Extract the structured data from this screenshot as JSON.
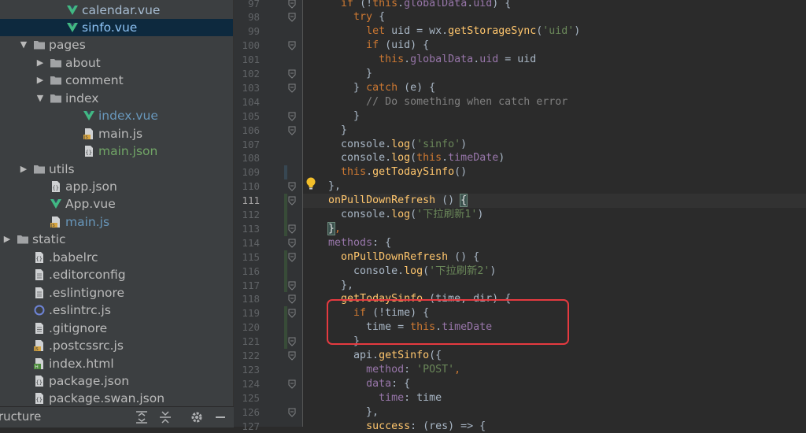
{
  "project_tree": {
    "items": [
      {
        "label": "calendar.vue",
        "depth": 3,
        "arrow": "",
        "icon": "vue-file-icon",
        "style": "vue"
      },
      {
        "label": "sinfo.vue",
        "depth": 3,
        "arrow": "",
        "icon": "vue-file-icon",
        "style": "sel",
        "selected": true
      },
      {
        "label": "pages",
        "depth": 1,
        "arrow": "down",
        "icon": "folder-icon",
        "style": ""
      },
      {
        "label": "about",
        "depth": 2,
        "arrow": "right",
        "icon": "folder-icon",
        "style": ""
      },
      {
        "label": "comment",
        "depth": 2,
        "arrow": "right",
        "icon": "folder-icon",
        "style": ""
      },
      {
        "label": "index",
        "depth": 2,
        "arrow": "down",
        "icon": "folder-icon",
        "style": ""
      },
      {
        "label": "index.vue",
        "depth": 4,
        "arrow": "",
        "icon": "vue-file-icon",
        "style": "blue"
      },
      {
        "label": "main.js",
        "depth": 4,
        "arrow": "",
        "icon": "js-file-icon",
        "style": ""
      },
      {
        "label": "main.json",
        "depth": 4,
        "arrow": "",
        "icon": "json-file-icon",
        "style": "green"
      },
      {
        "label": "utils",
        "depth": 1,
        "arrow": "right",
        "icon": "folder-icon",
        "style": ""
      },
      {
        "label": "app.json",
        "depth": 2,
        "arrow": "",
        "icon": "json-file-icon",
        "style": ""
      },
      {
        "label": "App.vue",
        "depth": 2,
        "arrow": "",
        "icon": "vue-file-icon",
        "style": ""
      },
      {
        "label": "main.js",
        "depth": 2,
        "arrow": "",
        "icon": "js-file-icon",
        "style": "blue"
      },
      {
        "label": "static",
        "depth": 0,
        "arrow": "right",
        "icon": "folder-icon",
        "style": ""
      },
      {
        "label": ".babelrc",
        "depth": 1,
        "arrow": "",
        "icon": "config-file-icon",
        "style": ""
      },
      {
        "label": ".editorconfig",
        "depth": 1,
        "arrow": "",
        "icon": "text-file-icon",
        "style": ""
      },
      {
        "label": ".eslintignore",
        "depth": 1,
        "arrow": "",
        "icon": "text-file-icon",
        "style": ""
      },
      {
        "label": ".eslintrc.js",
        "depth": 1,
        "arrow": "",
        "icon": "eslint-file-icon",
        "style": ""
      },
      {
        "label": ".gitignore",
        "depth": 1,
        "arrow": "",
        "icon": "text-file-icon",
        "style": ""
      },
      {
        "label": ".postcssrc.js",
        "depth": 1,
        "arrow": "",
        "icon": "js-file-icon",
        "style": ""
      },
      {
        "label": "index.html",
        "depth": 1,
        "arrow": "",
        "icon": "html-file-icon",
        "style": ""
      },
      {
        "label": "package.json",
        "depth": 1,
        "arrow": "",
        "icon": "json-file-icon",
        "style": ""
      },
      {
        "label": "package.swan.json",
        "depth": 1,
        "arrow": "",
        "icon": "json-file-icon",
        "style": ""
      }
    ]
  },
  "structure_bar": {
    "label": "ructure"
  },
  "editor": {
    "current_line": 111,
    "lines": [
      {
        "n": 97,
        "tokens": [
          [
            "plain",
            "      "
          ],
          [
            "kw",
            "if"
          ],
          [
            "plain",
            " (!"
          ],
          [
            "kw",
            "this"
          ],
          [
            "plain",
            "."
          ],
          [
            "prop",
            "globalData"
          ],
          [
            "plain",
            "."
          ],
          [
            "prop",
            "uid"
          ],
          [
            "plain",
            ") {"
          ]
        ]
      },
      {
        "n": 98,
        "tokens": [
          [
            "plain",
            "        "
          ],
          [
            "kw",
            "try"
          ],
          [
            "plain",
            " {"
          ]
        ]
      },
      {
        "n": 99,
        "tokens": [
          [
            "plain",
            "          "
          ],
          [
            "kw",
            "let"
          ],
          [
            "plain",
            " uid = "
          ],
          [
            "plain",
            "wx"
          ],
          [
            "plain",
            "."
          ],
          [
            "fn",
            "getStorageSync"
          ],
          [
            "plain",
            "("
          ],
          [
            "str",
            "'uid'"
          ],
          [
            "plain",
            ")"
          ]
        ]
      },
      {
        "n": 100,
        "tokens": [
          [
            "plain",
            "          "
          ],
          [
            "kw",
            "if"
          ],
          [
            "plain",
            " (uid) {"
          ]
        ]
      },
      {
        "n": 101,
        "tokens": [
          [
            "plain",
            "            "
          ],
          [
            "kw",
            "this"
          ],
          [
            "plain",
            "."
          ],
          [
            "prop",
            "globalData"
          ],
          [
            "plain",
            "."
          ],
          [
            "prop",
            "uid"
          ],
          [
            "plain",
            " = uid"
          ]
        ]
      },
      {
        "n": 102,
        "tokens": [
          [
            "plain",
            "          }"
          ]
        ]
      },
      {
        "n": 103,
        "tokens": [
          [
            "plain",
            "        } "
          ],
          [
            "kw",
            "catch"
          ],
          [
            "plain",
            " (e) {"
          ]
        ]
      },
      {
        "n": 104,
        "tokens": [
          [
            "plain",
            "          "
          ],
          [
            "cm",
            "// Do something when catch error"
          ]
        ]
      },
      {
        "n": 105,
        "tokens": [
          [
            "plain",
            "        }"
          ]
        ]
      },
      {
        "n": 106,
        "tokens": [
          [
            "plain",
            "      }"
          ]
        ]
      },
      {
        "n": 107,
        "tokens": [
          [
            "plain",
            "      console."
          ],
          [
            "fn",
            "log"
          ],
          [
            "plain",
            "("
          ],
          [
            "str",
            "'sinfo'"
          ],
          [
            "plain",
            ")"
          ]
        ]
      },
      {
        "n": 108,
        "tokens": [
          [
            "plain",
            "      console."
          ],
          [
            "fn",
            "log"
          ],
          [
            "plain",
            "("
          ],
          [
            "kw",
            "this"
          ],
          [
            "plain",
            "."
          ],
          [
            "prop",
            "timeDate"
          ],
          [
            "plain",
            ")"
          ]
        ]
      },
      {
        "n": 109,
        "tokens": [
          [
            "plain",
            "      "
          ],
          [
            "kw",
            "this"
          ],
          [
            "plain",
            "."
          ],
          [
            "fn",
            "getTodaySinfo"
          ],
          [
            "plain",
            "()"
          ]
        ]
      },
      {
        "n": 110,
        "tokens": [
          [
            "plain",
            "    },"
          ]
        ]
      },
      {
        "n": 111,
        "tokens": [
          [
            "plain",
            "    "
          ],
          [
            "fn",
            "onPullDownRefresh"
          ],
          [
            "plain",
            " () "
          ],
          [
            "brkt",
            "{"
          ]
        ]
      },
      {
        "n": 112,
        "tokens": [
          [
            "plain",
            "      console."
          ],
          [
            "fn",
            "log"
          ],
          [
            "plain",
            "("
          ],
          [
            "str",
            "'下拉刷新1'"
          ],
          [
            "plain",
            ")"
          ]
        ]
      },
      {
        "n": 113,
        "tokens": [
          [
            "plain",
            "    "
          ],
          [
            "brkt",
            "}"
          ],
          [
            "kw",
            ","
          ]
        ]
      },
      {
        "n": 114,
        "tokens": [
          [
            "plain",
            "    "
          ],
          [
            "prop",
            "methods"
          ],
          [
            "plain",
            ": {"
          ]
        ]
      },
      {
        "n": 115,
        "tokens": [
          [
            "plain",
            "      "
          ],
          [
            "fn",
            "onPullDownRefresh"
          ],
          [
            "plain",
            " () {"
          ]
        ]
      },
      {
        "n": 116,
        "tokens": [
          [
            "plain",
            "        console."
          ],
          [
            "fn",
            "log"
          ],
          [
            "plain",
            "("
          ],
          [
            "str",
            "'下拉刷新2'"
          ],
          [
            "plain",
            ")"
          ]
        ]
      },
      {
        "n": 117,
        "tokens": [
          [
            "plain",
            "      },"
          ]
        ]
      },
      {
        "n": 118,
        "tokens": [
          [
            "plain",
            "      "
          ],
          [
            "fn",
            "getTodaySinfo"
          ],
          [
            "plain",
            " (time, dir) {"
          ]
        ]
      },
      {
        "n": 119,
        "tokens": [
          [
            "plain",
            "        "
          ],
          [
            "kw",
            "if"
          ],
          [
            "plain",
            " (!time) {"
          ]
        ]
      },
      {
        "n": 120,
        "tokens": [
          [
            "plain",
            "          time = "
          ],
          [
            "kw",
            "this"
          ],
          [
            "plain",
            "."
          ],
          [
            "prop",
            "timeDate"
          ]
        ]
      },
      {
        "n": 121,
        "tokens": [
          [
            "plain",
            "        }"
          ]
        ]
      },
      {
        "n": 122,
        "tokens": [
          [
            "plain",
            "        api."
          ],
          [
            "fn",
            "getSinfo"
          ],
          [
            "plain",
            "({"
          ]
        ]
      },
      {
        "n": 123,
        "tokens": [
          [
            "plain",
            "          "
          ],
          [
            "prop",
            "method"
          ],
          [
            "plain",
            ": "
          ],
          [
            "str",
            "'POST'"
          ],
          [
            "kw",
            ","
          ]
        ]
      },
      {
        "n": 124,
        "tokens": [
          [
            "plain",
            "          "
          ],
          [
            "prop",
            "data"
          ],
          [
            "plain",
            ": {"
          ]
        ]
      },
      {
        "n": 125,
        "tokens": [
          [
            "plain",
            "            "
          ],
          [
            "prop",
            "time"
          ],
          [
            "plain",
            ": time"
          ]
        ]
      },
      {
        "n": 126,
        "tokens": [
          [
            "plain",
            "          },"
          ]
        ]
      },
      {
        "n": 127,
        "tokens": [
          [
            "plain",
            "          "
          ],
          [
            "fn",
            "success"
          ],
          [
            "plain",
            ": (res) => {"
          ]
        ]
      }
    ]
  },
  "colors": {
    "editor_bg": "#2b2b2b",
    "sidebar_bg": "#3c3f41",
    "keyword": "#cc7832",
    "string": "#6a8759",
    "function": "#ffc66d",
    "property": "#9876aa",
    "comment": "#808080",
    "annotation_box": "#e53a40"
  }
}
